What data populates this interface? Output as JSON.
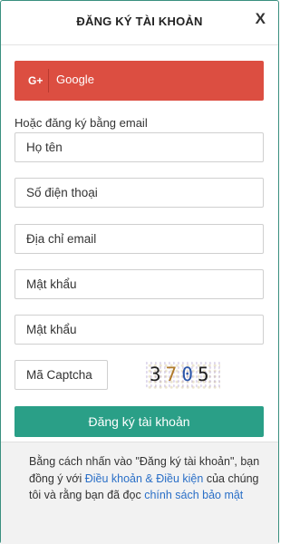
{
  "header": {
    "title": "ĐĂNG KÝ TÀI KHOẢN",
    "close_label": "X"
  },
  "google": {
    "icon": "G+",
    "label": "Google",
    "color": "#dc4e41"
  },
  "form": {
    "or_label": "Hoặc đăng ký bằng email",
    "fields": {
      "name": {
        "value": "",
        "placeholder": "Họ tên"
      },
      "phone": {
        "value": "",
        "placeholder": "Số điện thoại"
      },
      "email": {
        "value": "",
        "placeholder": "Địa chỉ email"
      },
      "password": {
        "value": "",
        "placeholder": "Mật khẩu"
      },
      "password_confirm": {
        "value": "",
        "placeholder": "Mật khẩu"
      },
      "captcha": {
        "value": "",
        "placeholder": "Mã Captcha"
      }
    },
    "captcha_code": [
      "3",
      "7",
      "0",
      "5"
    ],
    "submit_label": "Đăng ký tài khoản",
    "submit_color": "#2a9f87"
  },
  "footer": {
    "terms_prefix": "Bằng cách nhấn vào \"Đăng ký tài khoản\", bạn đồng ý với ",
    "terms_link": "Điều khoản & Điều kiện",
    "terms_middle": " của chúng tôi và rằng bạn đã đọc ",
    "privacy_link": "chính sách bảo mật",
    "link_color": "#2a6fc7"
  }
}
